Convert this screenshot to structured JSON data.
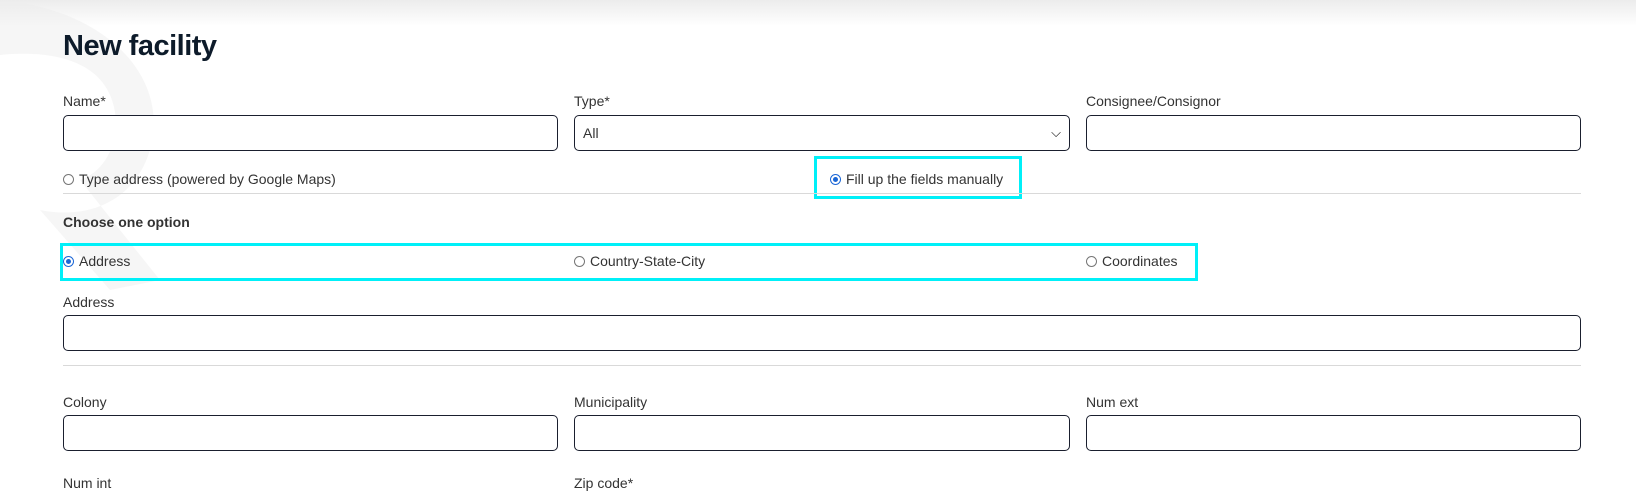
{
  "page": {
    "title": "New facility"
  },
  "form": {
    "name_label": "Name*",
    "type_label": "Type*",
    "type_value": "All",
    "consignee_label": "Consignee/Consignor",
    "address_mode_options": [
      {
        "label": "Type address (powered by Google Maps)",
        "selected": false
      },
      {
        "label": "Fill up the fields manually",
        "selected": true
      }
    ],
    "choose_heading": "Choose one option",
    "choose_options": [
      {
        "label": "Address",
        "selected": true
      },
      {
        "label": "Country-State-City",
        "selected": false
      },
      {
        "label": "Coordinates",
        "selected": false
      }
    ],
    "address_label": "Address",
    "colony_label": "Colony",
    "municipality_label": "Municipality",
    "num_ext_label": "Num ext",
    "num_int_label": "Num int",
    "zip_label": "Zip code*"
  },
  "colors": {
    "highlight": "#00f0f8",
    "radio_accent": "#1a66d6",
    "title": "#0d1b2a"
  }
}
